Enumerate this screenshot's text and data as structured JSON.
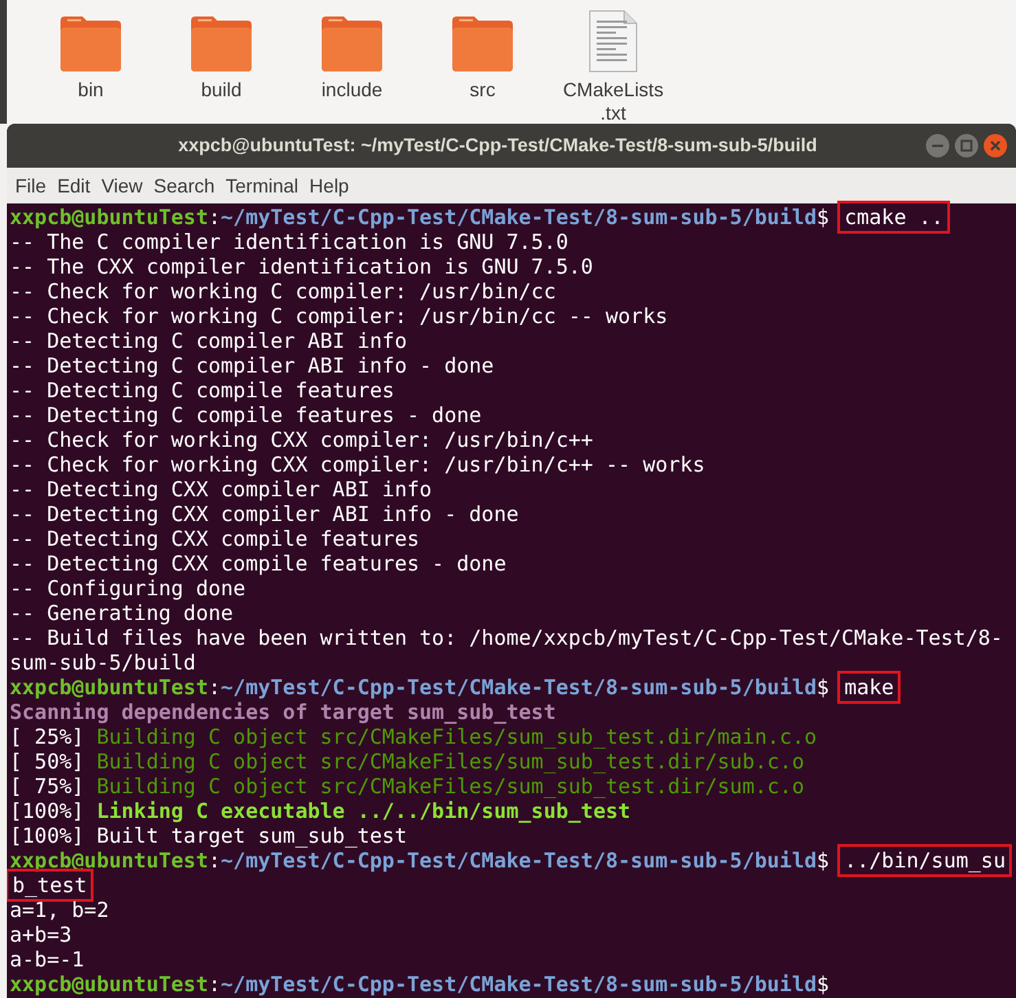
{
  "files": [
    {
      "kind": "folder",
      "name": "bin"
    },
    {
      "kind": "folder",
      "name": "build"
    },
    {
      "kind": "folder",
      "name": "include"
    },
    {
      "kind": "folder",
      "name": "src"
    },
    {
      "kind": "file",
      "name": "CMakeLists\n.txt"
    }
  ],
  "window": {
    "title": "xxpcb@ubuntuTest: ~/myTest/C-Cpp-Test/CMake-Test/8-sum-sub-5/build"
  },
  "menu": [
    "File",
    "Edit",
    "View",
    "Search",
    "Terminal",
    "Help"
  ],
  "terminal_lines": [
    [
      {
        "kind": "user",
        "text": "xxpcb@ubuntuTest"
      },
      {
        "kind": "plain",
        "text": ":"
      },
      {
        "kind": "path",
        "text": "~/myTest/C-Cpp-Test/CMake-Test/8-sum-sub-5/build"
      },
      {
        "kind": "plain",
        "text": "$ "
      },
      {
        "kind": "command",
        "text": "cmake ..",
        "highlighted": true
      }
    ],
    [
      {
        "kind": "plain",
        "text": "-- The C compiler identification is GNU 7.5.0"
      }
    ],
    [
      {
        "kind": "plain",
        "text": "-- The CXX compiler identification is GNU 7.5.0"
      }
    ],
    [
      {
        "kind": "plain",
        "text": "-- Check for working C compiler: /usr/bin/cc"
      }
    ],
    [
      {
        "kind": "plain",
        "text": "-- Check for working C compiler: /usr/bin/cc -- works"
      }
    ],
    [
      {
        "kind": "plain",
        "text": "-- Detecting C compiler ABI info"
      }
    ],
    [
      {
        "kind": "plain",
        "text": "-- Detecting C compiler ABI info - done"
      }
    ],
    [
      {
        "kind": "plain",
        "text": "-- Detecting C compile features"
      }
    ],
    [
      {
        "kind": "plain",
        "text": "-- Detecting C compile features - done"
      }
    ],
    [
      {
        "kind": "plain",
        "text": "-- Check for working CXX compiler: /usr/bin/c++"
      }
    ],
    [
      {
        "kind": "plain",
        "text": "-- Check for working CXX compiler: /usr/bin/c++ -- works"
      }
    ],
    [
      {
        "kind": "plain",
        "text": "-- Detecting CXX compiler ABI info"
      }
    ],
    [
      {
        "kind": "plain",
        "text": "-- Detecting CXX compiler ABI info - done"
      }
    ],
    [
      {
        "kind": "plain",
        "text": "-- Detecting CXX compile features"
      }
    ],
    [
      {
        "kind": "plain",
        "text": "-- Detecting CXX compile features - done"
      }
    ],
    [
      {
        "kind": "plain",
        "text": "-- Configuring done"
      }
    ],
    [
      {
        "kind": "plain",
        "text": "-- Generating done"
      }
    ],
    [
      {
        "kind": "plain",
        "text": "-- Build files have been written to: /home/xxpcb/myTest/C-Cpp-Test/CMake-Test/8-"
      }
    ],
    [
      {
        "kind": "plain",
        "text": "sum-sub-5/build"
      }
    ],
    [
      {
        "kind": "user",
        "text": "xxpcb@ubuntuTest"
      },
      {
        "kind": "plain",
        "text": ":"
      },
      {
        "kind": "path",
        "text": "~/myTest/C-Cpp-Test/CMake-Test/8-sum-sub-5/build"
      },
      {
        "kind": "plain",
        "text": "$ "
      },
      {
        "kind": "command",
        "text": "make",
        "highlighted": true
      }
    ],
    [
      {
        "kind": "scanning",
        "text": "Scanning dependencies of target sum_sub_test"
      }
    ],
    [
      {
        "kind": "plain",
        "text": "[ 25%] "
      },
      {
        "kind": "building",
        "text": "Building C object src/CMakeFiles/sum_sub_test.dir/main.c.o"
      }
    ],
    [
      {
        "kind": "plain",
        "text": "[ 50%] "
      },
      {
        "kind": "building",
        "text": "Building C object src/CMakeFiles/sum_sub_test.dir/sub.c.o"
      }
    ],
    [
      {
        "kind": "plain",
        "text": "[ 75%] "
      },
      {
        "kind": "building",
        "text": "Building C object src/CMakeFiles/sum_sub_test.dir/sum.c.o"
      }
    ],
    [
      {
        "kind": "plain",
        "text": "[100%] "
      },
      {
        "kind": "linking",
        "text": "Linking C executable ../../bin/sum_sub_test"
      }
    ],
    [
      {
        "kind": "plain",
        "text": "[100%] Built target sum_sub_test"
      }
    ],
    [
      {
        "kind": "user",
        "text": "xxpcb@ubuntuTest"
      },
      {
        "kind": "plain",
        "text": ":"
      },
      {
        "kind": "path",
        "text": "~/myTest/C-Cpp-Test/CMake-Test/8-sum-sub-5/build"
      },
      {
        "kind": "plain",
        "text": "$ "
      },
      {
        "kind": "command",
        "text": "../bin/sum_su",
        "highlighted": true
      }
    ],
    [
      {
        "kind": "command",
        "text": "b_test",
        "highlighted": true
      }
    ],
    [
      {
        "kind": "plain",
        "text": "a=1, b=2"
      }
    ],
    [
      {
        "kind": "plain",
        "text": "a+b=3"
      }
    ],
    [
      {
        "kind": "plain",
        "text": "a-b=-1"
      }
    ],
    [
      {
        "kind": "user",
        "text": "xxpcb@ubuntuTest"
      },
      {
        "kind": "plain",
        "text": ":"
      },
      {
        "kind": "path",
        "text": "~/myTest/C-Cpp-Test/CMake-Test/8-sum-sub-5/build"
      },
      {
        "kind": "plain",
        "text": "$"
      }
    ]
  ]
}
